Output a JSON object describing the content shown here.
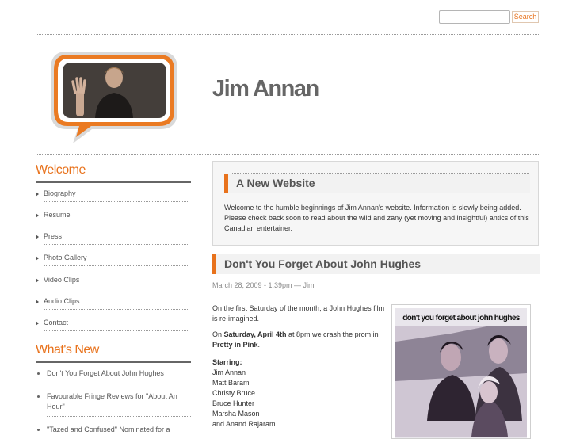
{
  "header": {
    "search_placeholder": "",
    "search_button": "Search"
  },
  "site": {
    "title": "Jim Annan"
  },
  "sidebar": {
    "welcome_heading": "Welcome",
    "nav": [
      {
        "label": "Biography"
      },
      {
        "label": "Resume"
      },
      {
        "label": "Press"
      },
      {
        "label": "Photo Gallery"
      },
      {
        "label": "Video Clips"
      },
      {
        "label": "Audio Clips"
      },
      {
        "label": "Contact"
      }
    ],
    "news_heading": "What's New",
    "news": [
      {
        "label": "Don't You Forget About John Hughes"
      },
      {
        "label": "Favourable Fringe Reviews for \"About An Hour\""
      },
      {
        "label": "\"Tazed and Confused\" Nominated for a"
      }
    ]
  },
  "posts": {
    "first": {
      "title": "A New Website",
      "body": "Welcome to the humble beginnings of Jim Annan's website. Information is slowly being added. Please check back soon to read about the wild and zany (yet moving and insightful) antics of this Canadian entertainer."
    },
    "second": {
      "title": "Don't You Forget About John Hughes",
      "meta": "March 28, 2009 - 1:39pm — Jim",
      "p1": "On the first Saturday of the month, a John Hughes film is re-imagined.",
      "p2_pre": "On ",
      "p2_date": "Saturday, April 4th",
      "p2_mid": " at 8pm we crash the prom in ",
      "p2_film": "Pretty in Pink",
      "p2_end": ".",
      "starring_label": "Starring:",
      "cast": [
        "Jim Annan",
        "Matt Baram",
        "Christy Bruce",
        "Bruce Hunter",
        "Marsha Mason",
        "and Anand Rajaram"
      ],
      "poster_title": "don't you forget about john hughes"
    }
  },
  "colors": {
    "accent": "#e8721c",
    "text": "#333333",
    "heading": "#666666"
  }
}
